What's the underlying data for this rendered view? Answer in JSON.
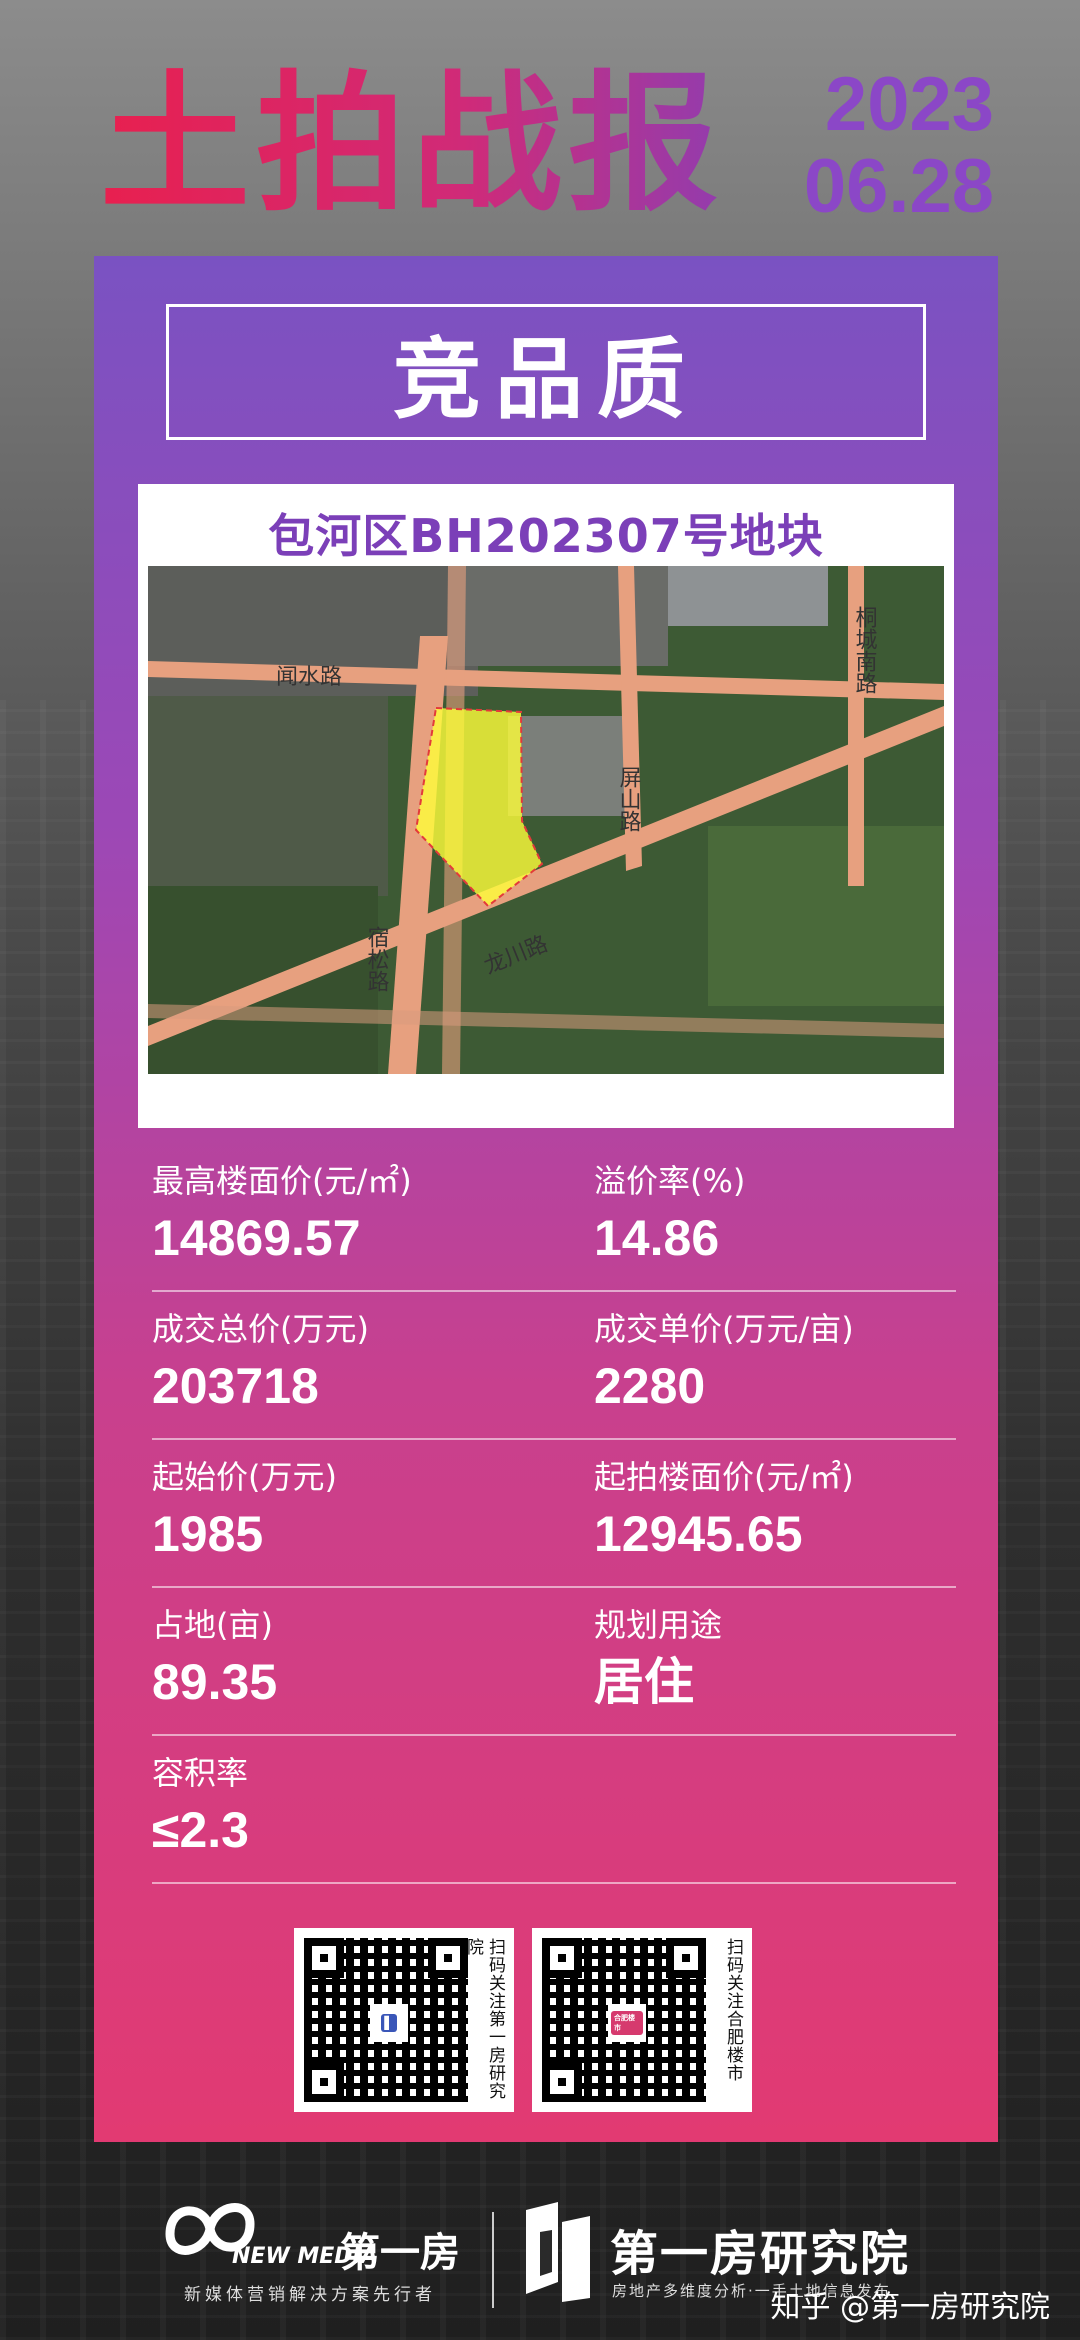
{
  "header": {
    "headline": "土拍战报",
    "date_year": "2023",
    "date_day": "06.28"
  },
  "card": {
    "subtitle": "竞品质",
    "plot_title": "包河区BH202307号地块",
    "map_labels": {
      "road_1": "闻水路",
      "road_2": "屏山路",
      "road_3": "桐城南路",
      "road_4": "宿松路",
      "road_5": "龙川路"
    }
  },
  "stats": {
    "max_floor_price_label": "最高楼面价(元/㎡)",
    "max_floor_price_value": "14869.57",
    "premium_rate_label": "溢价率(%)",
    "premium_rate_value": "14.86",
    "total_price_label": "成交总价(万元)",
    "total_price_value": "203718",
    "unit_price_label": "成交单价(万元/亩)",
    "unit_price_value": "2280",
    "start_price_label": "起始价(万元)",
    "start_price_value": "1985",
    "start_floor_price_label": "起拍楼面价(元/㎡)",
    "start_floor_price_value": "12945.65",
    "area_label": "占地(亩)",
    "area_value": "89.35",
    "usage_label": "规划用途",
    "usage_value": "居住",
    "far_label": "容积率",
    "far_value": "≤2.3"
  },
  "qr": {
    "caption_1": "扫码关注第一房研究院",
    "caption_2": "扫码关注合肥楼市",
    "center_badge_2": "合肥楼市"
  },
  "footer": {
    "newmedia_text": "NEW MEDIA",
    "newmedia_brand": "第一房",
    "newmedia_slogan": "新媒体营销解决方案先行者",
    "institute_brand": "第一房研究院",
    "institute_slogan": "房地产多维度分析·一手土地信息发布",
    "watermark": "知乎 @第一房研究院"
  },
  "colors": {
    "headline_pink": "#e8204f",
    "date_purple": "#8b47c7",
    "card_top": "#7a52c2",
    "card_bottom": "#e23a72",
    "plot_title": "#7b3fb8",
    "road": "#e7a07f",
    "plot_fill": "#ffff3a"
  }
}
